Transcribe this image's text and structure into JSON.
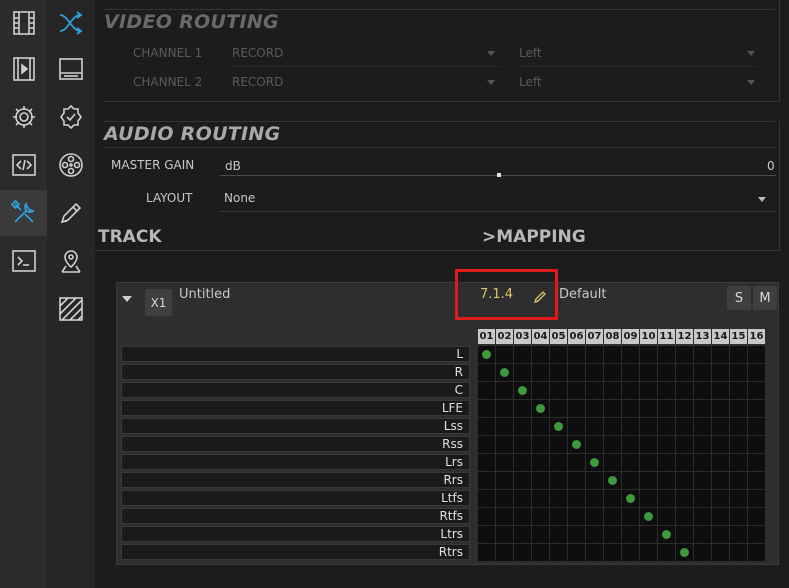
{
  "video_routing": {
    "title": "VIDEO ROUTING",
    "channels": [
      {
        "label": "CHANNEL 1",
        "source": "RECORD",
        "side": "Left"
      },
      {
        "label": "CHANNEL 2",
        "source": "RECORD",
        "side": "Left"
      }
    ]
  },
  "audio_routing": {
    "title": "AUDIO ROUTING",
    "master_gain_label": "MASTER GAIN",
    "gain_unit": "dB",
    "gain_value": "0",
    "layout_label": "LAYOUT",
    "layout_value": "None"
  },
  "headers": {
    "track": "TRACK",
    "mapping": ">MAPPING"
  },
  "track": {
    "id": "X1",
    "name": "Untitled",
    "format": "7.1.4",
    "preset": "Default",
    "solo_label": "S",
    "mute_label": "M"
  },
  "columns": [
    "01",
    "02",
    "03",
    "04",
    "05",
    "06",
    "07",
    "08",
    "09",
    "10",
    "11",
    "12",
    "13",
    "14",
    "15",
    "16"
  ],
  "channels": [
    "L",
    "R",
    "C",
    "LFE",
    "Lss",
    "Rss",
    "Lrs",
    "Rrs",
    "Ltfs",
    "Rtfs",
    "Ltrs",
    "Rtrs"
  ],
  "mapping": [
    0,
    1,
    2,
    3,
    4,
    5,
    6,
    7,
    8,
    9,
    10,
    11
  ],
  "colors": {
    "accent": "#2fa0d8",
    "dot": "#3d9a3d",
    "highlight": "#e01b1b"
  },
  "icons": {
    "rail1": [
      "film-strip-icon",
      "video-play-icon",
      "gear-icon",
      "code-icon",
      "tools-icon",
      "terminal-icon"
    ],
    "rail2": [
      "routing-shuffle-icon",
      "monitor-icon",
      "check-badge-icon",
      "film-reel-icon",
      "pen-icon",
      "map-pin-icon",
      "hatch-icon"
    ]
  }
}
